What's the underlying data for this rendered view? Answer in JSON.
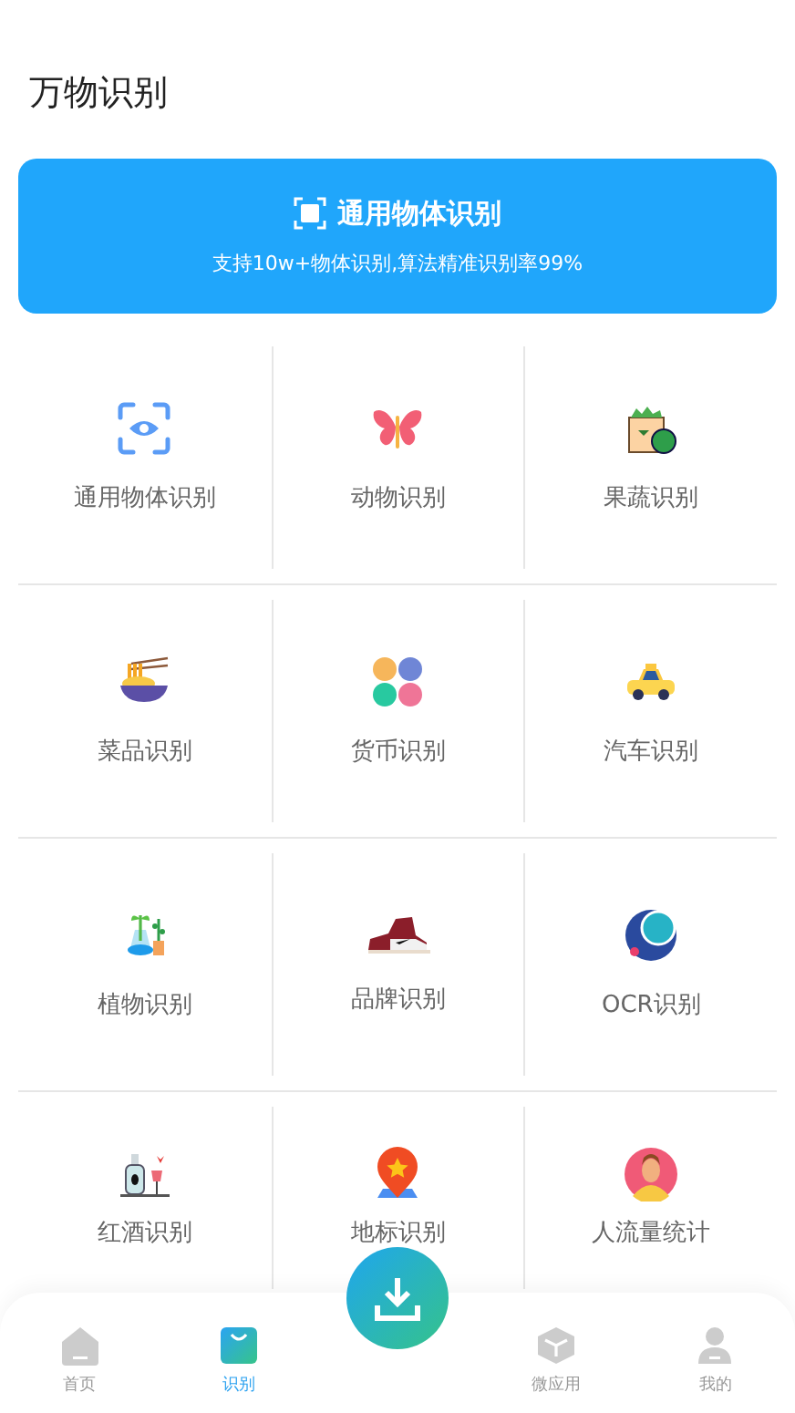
{
  "header": {
    "title": "万物识别"
  },
  "banner": {
    "title": "通用物体识别",
    "subtitle": "支持10w+物体识别,算法精准识别率99%"
  },
  "grid": [
    {
      "label": "通用物体识别"
    },
    {
      "label": "动物识别"
    },
    {
      "label": "果蔬识别"
    },
    {
      "label": "菜品识别"
    },
    {
      "label": "货币识别"
    },
    {
      "label": "汽车识别"
    },
    {
      "label": "植物识别"
    },
    {
      "label": "品牌识别"
    },
    {
      "label": "OCR识别"
    },
    {
      "label": "红酒识别"
    },
    {
      "label": "地标识别"
    },
    {
      "label": "人流量统计"
    }
  ],
  "tab_bar": [
    {
      "label": "首页",
      "selected": false
    },
    {
      "label": "识别",
      "selected": true
    },
    {
      "label": "微应用",
      "selected": false
    },
    {
      "label": "我的",
      "selected": false
    }
  ]
}
